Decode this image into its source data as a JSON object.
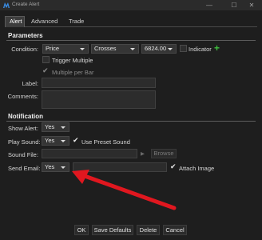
{
  "window": {
    "title": "Create Alert",
    "minimize": "—",
    "maximize": "☐",
    "close": "✕"
  },
  "tabs": [
    "Alert",
    "Advanced",
    "Trade"
  ],
  "parameters": {
    "heading": "Parameters",
    "condition_label": "Condition:",
    "condition_value": "Price",
    "operator_value": "Crosses",
    "price_value": "6824.00",
    "indicator_label": "Indicator",
    "plus": "+",
    "trigger_multiple_label": "Trigger Multiple",
    "multiple_per_bar_label": "Multiple per Bar",
    "label_label": "Label:",
    "comments_label": "Comments:"
  },
  "notification": {
    "heading": "Notification",
    "show_alert_label": "Show Alert:",
    "show_alert_value": "Yes",
    "play_sound_label": "Play Sound:",
    "play_sound_value": "Yes",
    "use_preset_sound_label": "Use Preset Sound",
    "sound_file_label": "Sound File:",
    "play_glyph": "▶",
    "browse_label": "Browse",
    "send_email_label": "Send Email:",
    "send_email_value": "Yes",
    "attach_image_label": "Attach Image"
  },
  "buttons": {
    "ok": "OK",
    "save_defaults": "Save Defaults",
    "delete": "Delete",
    "cancel": "Cancel"
  },
  "check_glyph": "✔",
  "colors": {
    "background": "#1e1e1e",
    "accent_arrow": "#e0171f",
    "plus": "#3fbf3f",
    "app_icon": "#3a8ee6"
  }
}
